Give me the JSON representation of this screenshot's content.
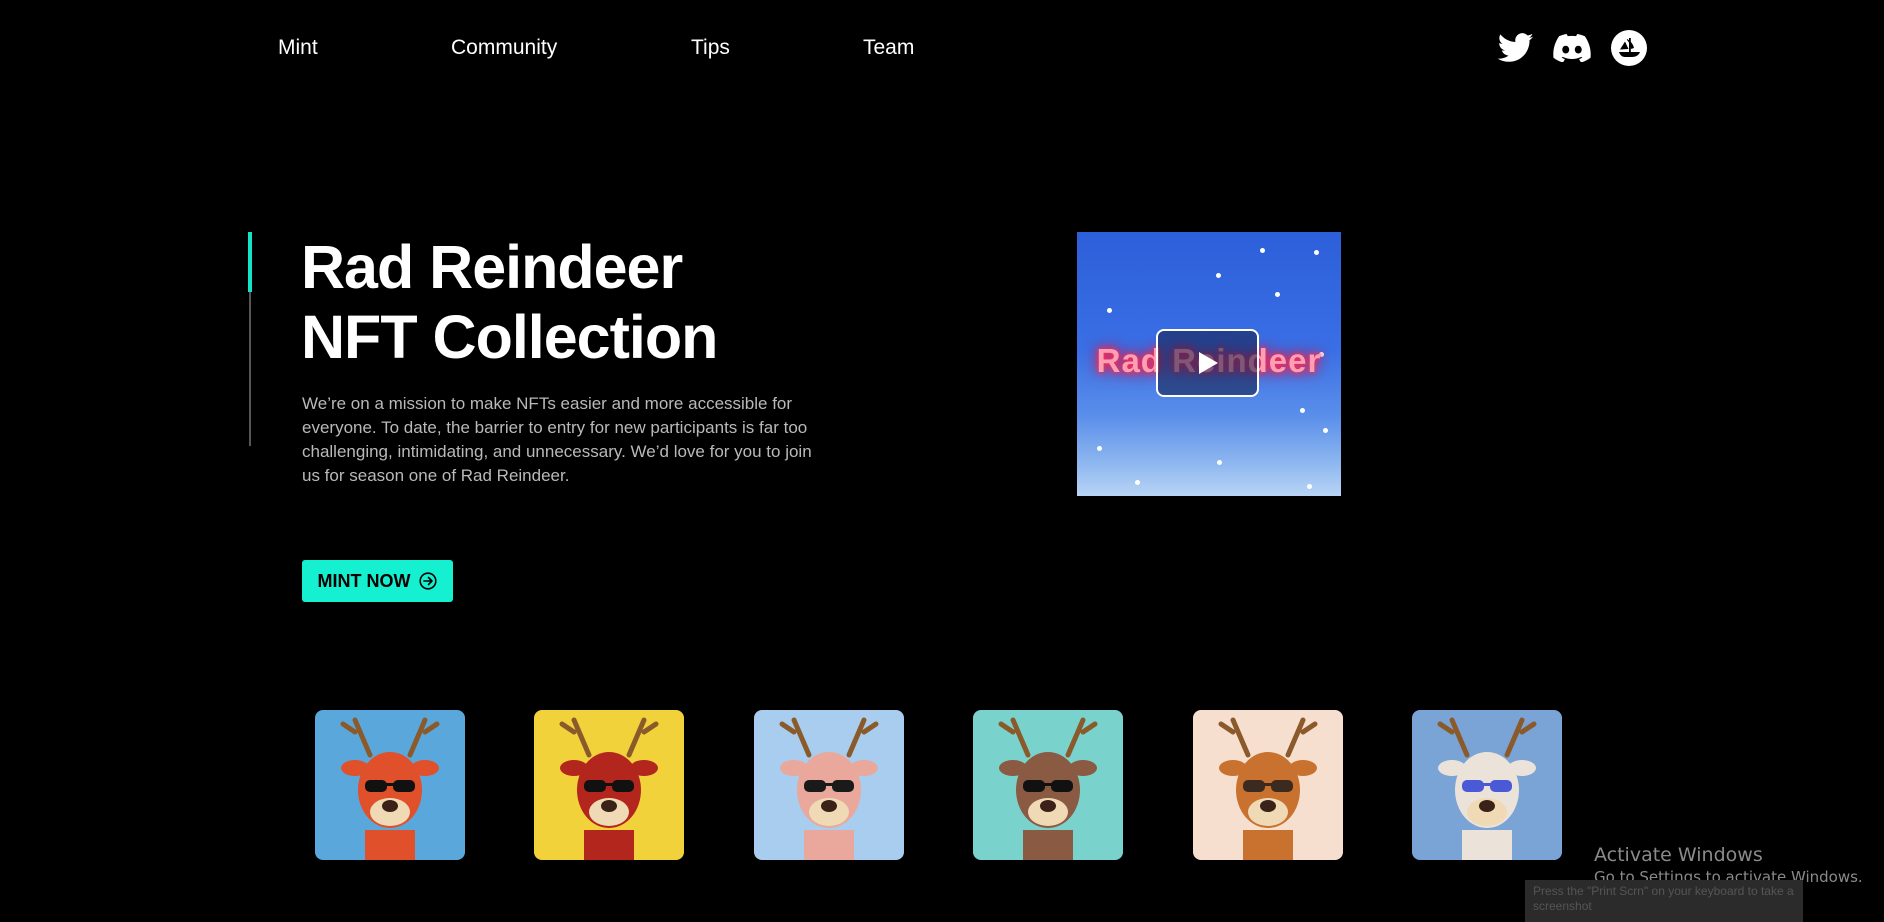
{
  "nav": {
    "links": [
      "Mint",
      "Community",
      "Tips",
      "Team"
    ],
    "social": [
      "twitter-icon",
      "discord-icon",
      "opensea-icon"
    ]
  },
  "hero": {
    "title_line1": "Rad Reindeer",
    "title_line2": "NFT Collection",
    "description": "We’re on a mission to make NFTs easier and more accessible for everyone. To date, the barrier to entry for new participants is far too challenging, intimidating, and unnecessary. We’d love for you to join us for season one of Rad Reindeer.",
    "button_label": "MINT NOW",
    "accent_color": "#14f0d0"
  },
  "video": {
    "title_text": "Rad Reindeer",
    "play_icon": "play-icon"
  },
  "gallery": {
    "items": [
      {
        "bg": "#5aa7dc",
        "fur": "#e0502a",
        "glasses": "#111111"
      },
      {
        "bg": "#f2d23a",
        "fur": "#b3261e",
        "glasses": "#111111"
      },
      {
        "bg": "#a9cdee",
        "fur": "#e9a89b",
        "glasses": "#1a1a1a"
      },
      {
        "bg": "#79d3cc",
        "fur": "#8a5a42",
        "glasses": "#111111"
      },
      {
        "bg": "#f7dfcf",
        "fur": "#c9722f",
        "glasses": "#3a2a20"
      },
      {
        "bg": "#7aa3d6",
        "fur": "#ebe3da",
        "glasses": "#4a5ad6"
      }
    ]
  },
  "system": {
    "watermark_title": "Activate Windows",
    "watermark_sub": "Go to Settings to activate Windows.",
    "toast_text": "Press the \"Print Scrn\" on your keyboard to take a screenshot"
  }
}
